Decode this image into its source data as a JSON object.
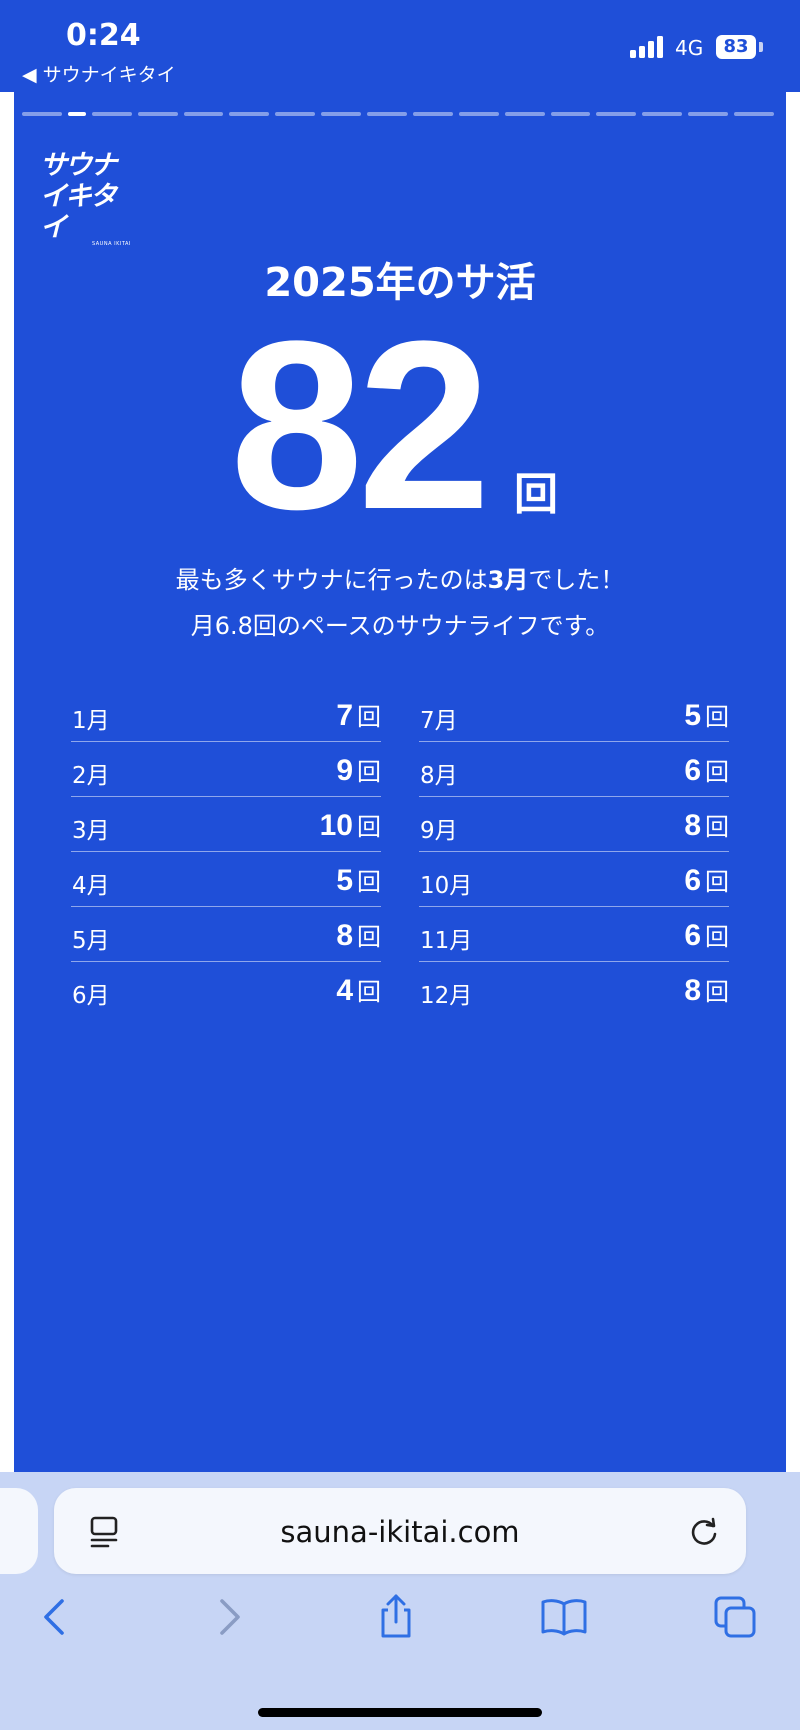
{
  "status": {
    "time": "0:24",
    "back_app": "◀ サウナイキタイ",
    "network": "4G",
    "battery": "83"
  },
  "logo": {
    "line1": "サウナ",
    "line2": "イキタイ",
    "sub": "SAUNA IKITAI"
  },
  "summary": {
    "title": "2025年のサ活",
    "total": "82",
    "unit": "回",
    "message_pre": "最も多くサウナに行ったのは",
    "message_highlight": "3月",
    "message_post": "でした！",
    "message2": "月6.8回のペースのサウナライフです。"
  },
  "months_left": [
    {
      "month": "1月",
      "count": "7",
      "unit": "回"
    },
    {
      "month": "2月",
      "count": "9",
      "unit": "回"
    },
    {
      "month": "3月",
      "count": "10",
      "unit": "回"
    },
    {
      "month": "4月",
      "count": "5",
      "unit": "回"
    },
    {
      "month": "5月",
      "count": "8",
      "unit": "回"
    },
    {
      "month": "6月",
      "count": "4",
      "unit": "回"
    }
  ],
  "months_right": [
    {
      "month": "7月",
      "count": "5",
      "unit": "回"
    },
    {
      "month": "8月",
      "count": "6",
      "unit": "回"
    },
    {
      "month": "9月",
      "count": "8",
      "unit": "回"
    },
    {
      "month": "10月",
      "count": "6",
      "unit": "回"
    },
    {
      "month": "11月",
      "count": "6",
      "unit": "回"
    },
    {
      "month": "12月",
      "count": "8",
      "unit": "回"
    }
  ],
  "browser": {
    "url": "sauna-ikitai.com"
  },
  "icons": {
    "reader": "reader-mode-icon",
    "reload": "reload-icon",
    "back": "chevron-left-icon",
    "forward": "chevron-right-icon",
    "share": "share-icon",
    "bookmarks": "book-icon",
    "tabs": "tabs-icon"
  },
  "colors": {
    "background": "#1f4fd8",
    "browser_bar": "#c7d5f5",
    "accent_icon": "#2f6fe4"
  }
}
